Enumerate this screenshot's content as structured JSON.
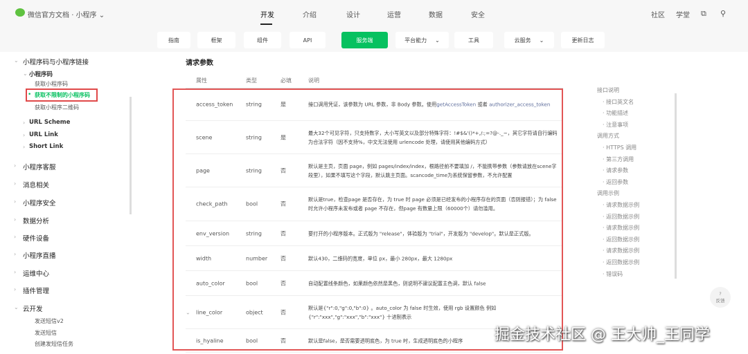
{
  "header": {
    "brand": "微信官方文档",
    "separator": "·",
    "product": "小程序",
    "nav": [
      "开发",
      "介绍",
      "设计",
      "运营",
      "数据",
      "安全"
    ],
    "right": [
      "社区",
      "学堂"
    ]
  },
  "subnav": [
    {
      "label": "指南"
    },
    {
      "label": "框架"
    },
    {
      "label": "组件"
    },
    {
      "label": "API"
    },
    {
      "label": "服务端",
      "active": true
    },
    {
      "label": "平台能力",
      "dropdown": true
    },
    {
      "label": "工具"
    },
    {
      "label": "云服务",
      "dropdown": true
    },
    {
      "label": "更新日志"
    }
  ],
  "sidebar": [
    {
      "label": "小程序码与小程序链接",
      "level": 1,
      "open": true
    },
    {
      "label": "小程序码",
      "level": 2,
      "open": true
    },
    {
      "label": "获取小程序码",
      "level": 3
    },
    {
      "label": "获取不限制的小程序码",
      "level": 3,
      "active": true
    },
    {
      "label": "获取小程序二维码",
      "level": 3
    },
    {
      "label": "URL Scheme",
      "level": 2
    },
    {
      "label": "URL Link",
      "level": 2
    },
    {
      "label": "Short Link",
      "level": 2
    },
    {
      "label": "小程序客服",
      "level": 1
    },
    {
      "label": "消息相关",
      "level": 1
    },
    {
      "label": "小程序安全",
      "level": 1
    },
    {
      "label": "数据分析",
      "level": 1
    },
    {
      "label": "硬件设备",
      "level": 1
    },
    {
      "label": "小程序直播",
      "level": 1
    },
    {
      "label": "运维中心",
      "level": 1
    },
    {
      "label": "插件管理",
      "level": 1
    },
    {
      "label": "云开发",
      "level": 1,
      "open": true
    },
    {
      "label": "发送短信v2",
      "level": 3
    },
    {
      "label": "发送短信",
      "level": 3
    },
    {
      "label": "创建发短信任务",
      "level": 3
    }
  ],
  "section_title": "请求参数",
  "table": {
    "headers": [
      "属性",
      "类型",
      "必填",
      "说明"
    ],
    "rows": [
      {
        "name": "access_token",
        "type": "string",
        "required": "是",
        "desc": "接口调用凭证，该参数为 URL 参数，非 Body 参数。使用",
        "link1": "getAccessToken",
        "mid": " 或者 ",
        "link2": "authorizer_access_token"
      },
      {
        "name": "scene",
        "type": "string",
        "required": "是",
        "desc": "最大32个可见字符，只支持数字，大小写英文以及部分特殊字符：!#$&'()*+,/:;=?@-._~，其它字符请自行编码为合法字符（因不支持%，中文无法使用 urlencode 处理，请使用其他编码方式）"
      },
      {
        "name": "page",
        "type": "string",
        "required": "否",
        "desc": "默认是主页，页面 page，例如 pages/index/index，根路径前不要填加 /，不能携带参数（参数请放在scene字段里），如果不填写这个字段，默认跳主页面。scancode_time为系统保留参数，不允许配置"
      },
      {
        "name": "check_path",
        "type": "bool",
        "required": "否",
        "desc": "默认是true，检查page 是否存在，为 true 时 page 必须是已经发布的小程序存在的页面（否则报错）；为 false 时允许小程序未发布或者 page 不存在，但page 有数量上限（60000个）请勿滥用。"
      },
      {
        "name": "env_version",
        "type": "string",
        "required": "否",
        "desc": "要打开的小程序版本。正式版为 \"release\"，体验版为 \"trial\"，开发版为 \"develop\"。默认是正式版。"
      },
      {
        "name": "width",
        "type": "number",
        "required": "否",
        "desc": "默认430，二维码的宽度，单位 px，最小 280px，最大 1280px"
      },
      {
        "name": "auto_color",
        "type": "bool",
        "required": "否",
        "desc": "自动配置线条颜色，如果颜色依然是黑色，则说明不建议配置主色调，默认 false"
      },
      {
        "name": "line_color",
        "type": "object",
        "required": "否",
        "desc": "默认是{\"r\":0,\"g\":0,\"b\":0} 。auto_color 为 false 时生效，使用 rgb 设置颜色 例如 {\"r\":\"xxx\",\"g\":\"xxx\",\"b\":\"xxx\"} 十进制表示",
        "expandable": true
      },
      {
        "name": "is_hyaline",
        "type": "bool",
        "required": "否",
        "desc": "默认是false，是否需要透明底色，为 true 时，生成透明底色的小程序"
      }
    ]
  },
  "toc": [
    {
      "label": "接口说明",
      "level": 1
    },
    {
      "label": "接口英文名",
      "level": 2
    },
    {
      "label": "功能描述",
      "level": 2
    },
    {
      "label": "注意事项",
      "level": 2
    },
    {
      "label": "调用方式",
      "level": 1
    },
    {
      "label": "HTTPS 调用",
      "level": 2
    },
    {
      "label": "第三方调用",
      "level": 2
    },
    {
      "label": "请求参数",
      "level": 2
    },
    {
      "label": "返回参数",
      "level": 2
    },
    {
      "label": "调用示例",
      "level": 1
    },
    {
      "label": "请求数据示例",
      "level": 2
    },
    {
      "label": "返回数据示例",
      "level": 2
    },
    {
      "label": "请求数据示例",
      "level": 2
    },
    {
      "label": "返回数据示例",
      "level": 2
    },
    {
      "label": "请求数据示例",
      "level": 2
    },
    {
      "label": "返回数据示例",
      "level": 2
    },
    {
      "label": "错误码",
      "level": 2
    }
  ],
  "feedback": {
    "icon": "?",
    "label": "反馈"
  },
  "watermark": "掘金技术社区 @ 王大帅_王同学",
  "colors": {
    "accent": "#07c160",
    "highlight": "#e04848"
  }
}
